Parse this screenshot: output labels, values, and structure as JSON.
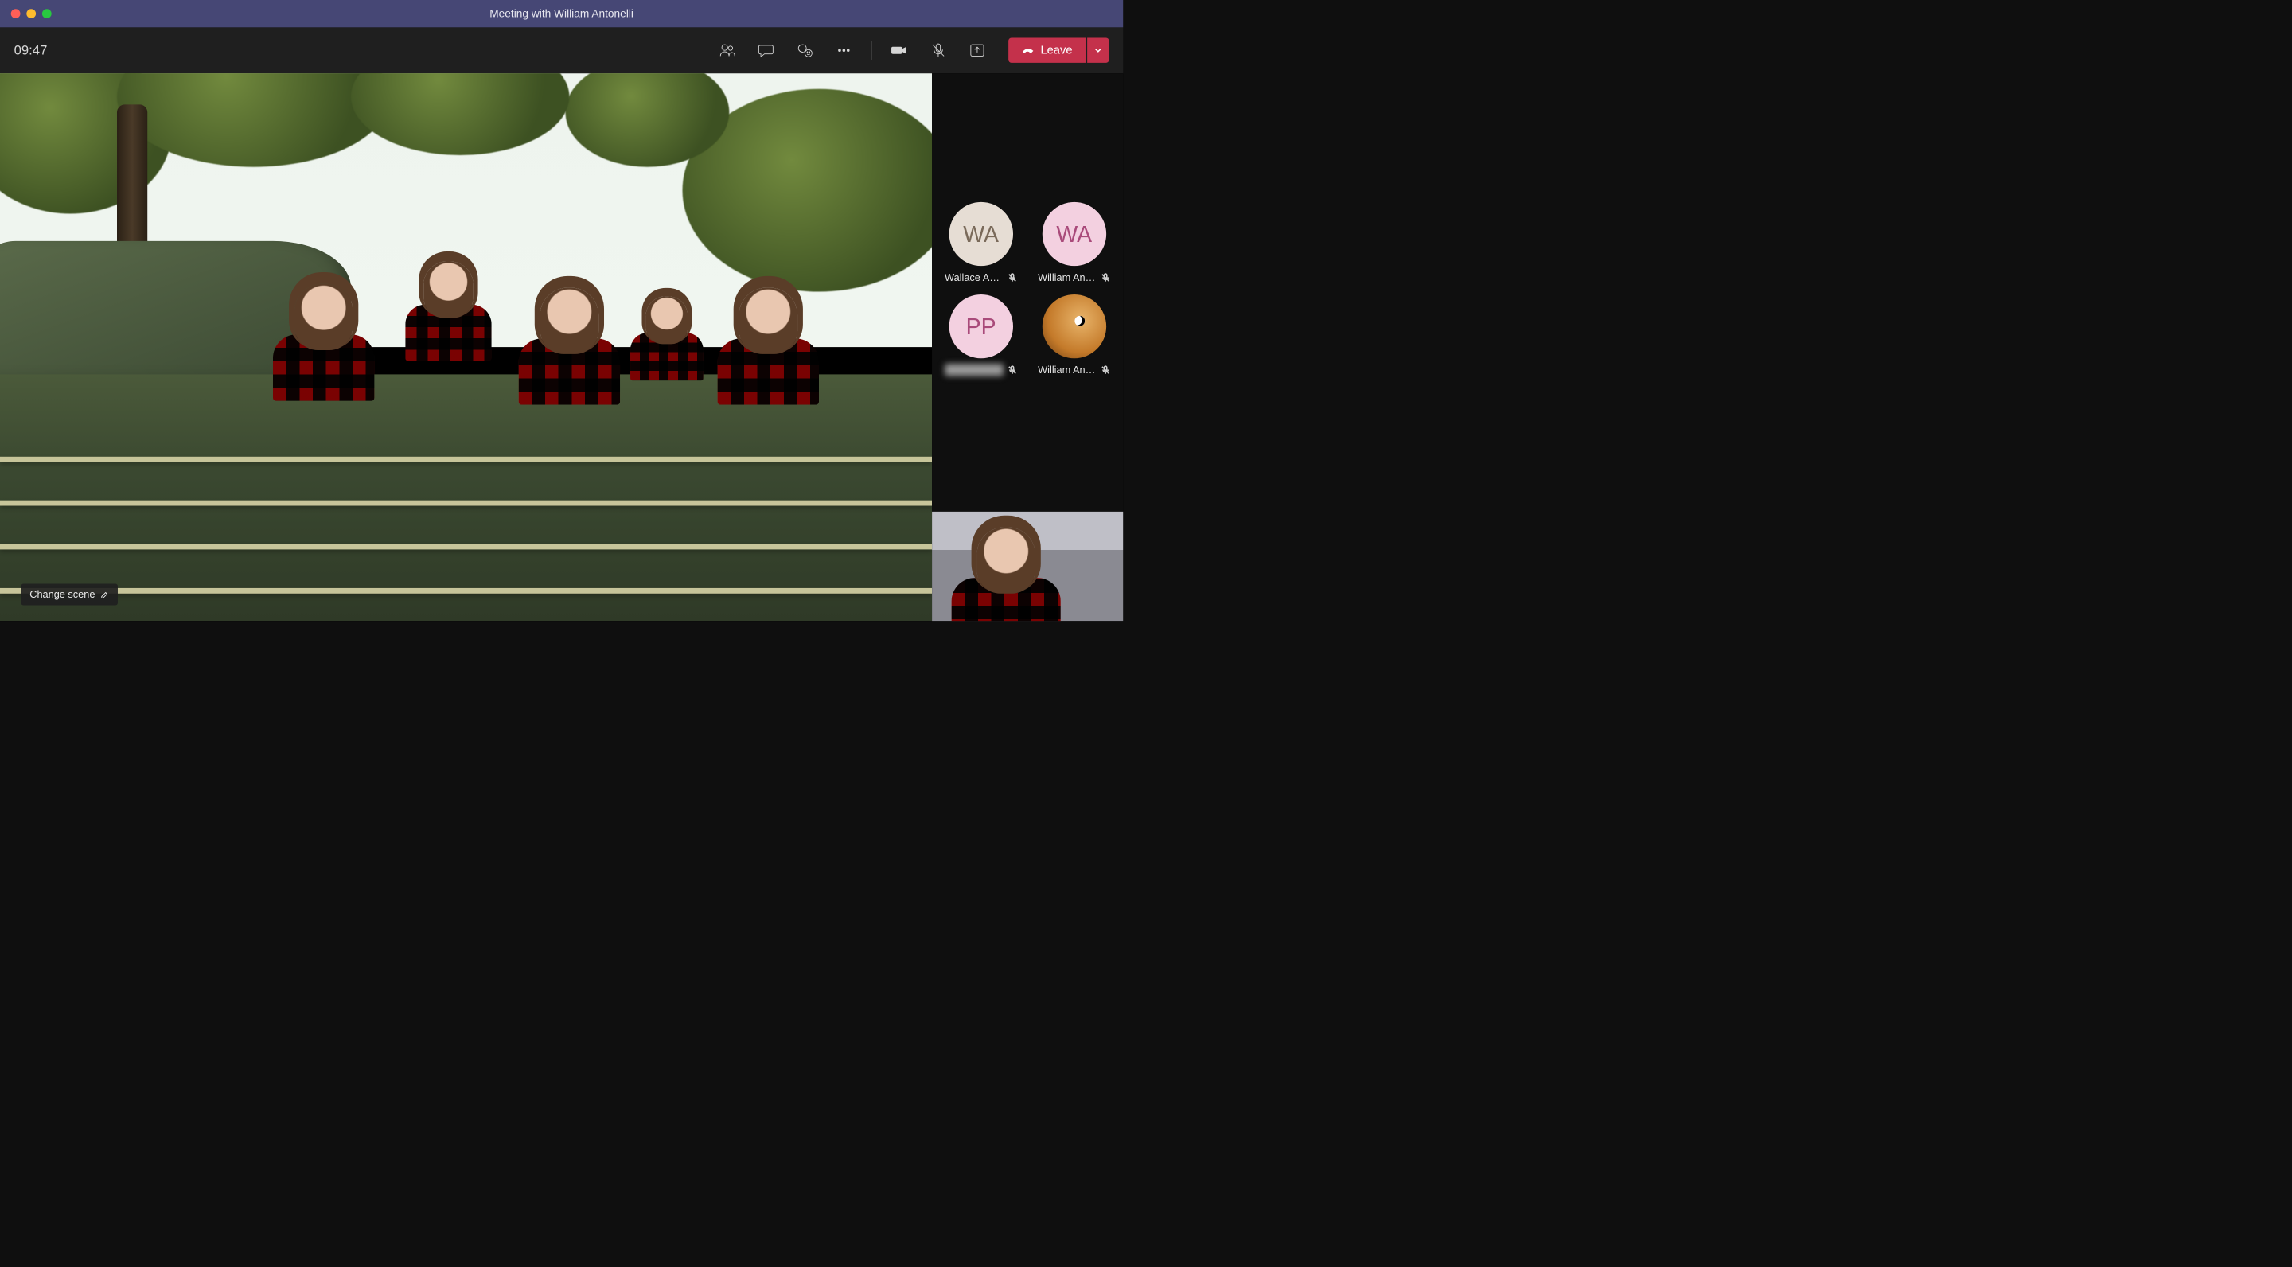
{
  "window": {
    "title": "Meeting with William Antonelli"
  },
  "toolbar": {
    "timer": "09:47",
    "leave_label": "Leave"
  },
  "stage": {
    "change_scene_label": "Change scene"
  },
  "participants": [
    {
      "initials": "WA",
      "name": "Wallace Ant...",
      "avatar_style": "a",
      "muted": true
    },
    {
      "initials": "WA",
      "name": "William Ant...",
      "avatar_style": "b",
      "muted": true
    },
    {
      "initials": "PP",
      "name": "——————",
      "avatar_style": "c",
      "muted": true,
      "blurred": true
    },
    {
      "initials": "",
      "name": "William Ant...",
      "avatar_style": "d",
      "muted": true
    }
  ],
  "icons": {
    "participants": "participants-icon",
    "chat": "chat-icon",
    "reactions": "reactions-icon",
    "more": "more-icon",
    "camera": "camera-icon",
    "mic_muted": "mic-muted-icon",
    "share": "share-icon",
    "hangup": "hangup-icon",
    "chevron_down": "chevron-down-icon",
    "edit": "edit-icon"
  },
  "colors": {
    "titlebar": "#464775",
    "background": "#1f1f1f",
    "leave": "#c4314b"
  }
}
